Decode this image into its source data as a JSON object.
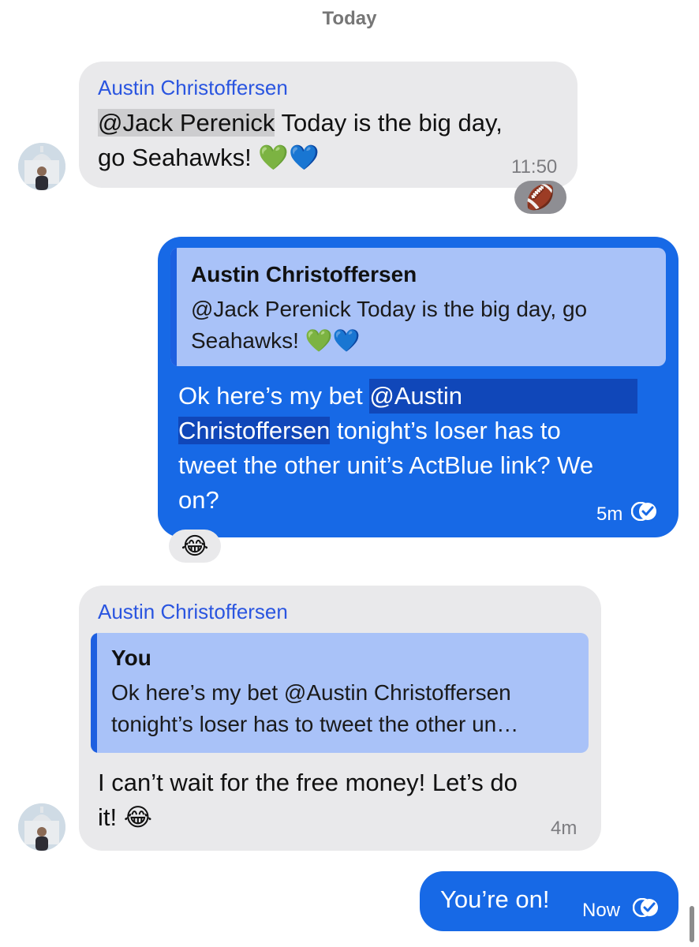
{
  "date_separator": "Today",
  "messages": [
    {
      "sender": "Austin Christoffersen",
      "mention": "@Jack Perenick",
      "text_line1_rest": " Today is the big day,",
      "text_line2": "go Seahawks! 💚💙",
      "time": "11:50",
      "reaction": "🏈"
    },
    {
      "quote_name": "Austin Christoffersen",
      "quote_line1": "@Jack Perenick Today is the big day, go",
      "quote_line2": "Seahawks! 💚💙",
      "line1_pre": "Ok here’s my bet ",
      "mention_part1": "@Austin",
      "mention_part2": "Christoffersen",
      "line2_rest": " tonight’s loser has to",
      "line3": "tweet the other unit’s ActBlue link? We",
      "line4": "on?",
      "time": "5m",
      "reaction": "😂"
    },
    {
      "sender": "Austin Christoffersen",
      "quote_name": "You",
      "quote_line1": "Ok here’s my bet @Austin Christoffersen",
      "quote_line2": "tonight’s loser has to tweet the other un…",
      "line1": "I can’t wait for the free money! Let’s do",
      "line2": "it! 😂",
      "time": "4m"
    },
    {
      "text": "You’re on!",
      "time": "Now"
    }
  ],
  "icons": {
    "avatar": "user-avatar",
    "read_receipt": "double-check-icon"
  },
  "colors": {
    "outgoing_bubble": "#1769e6",
    "incoming_bubble": "#e9e9eb",
    "sender_name": "#2a55e0",
    "quote_bg": "#a9c2f8"
  }
}
